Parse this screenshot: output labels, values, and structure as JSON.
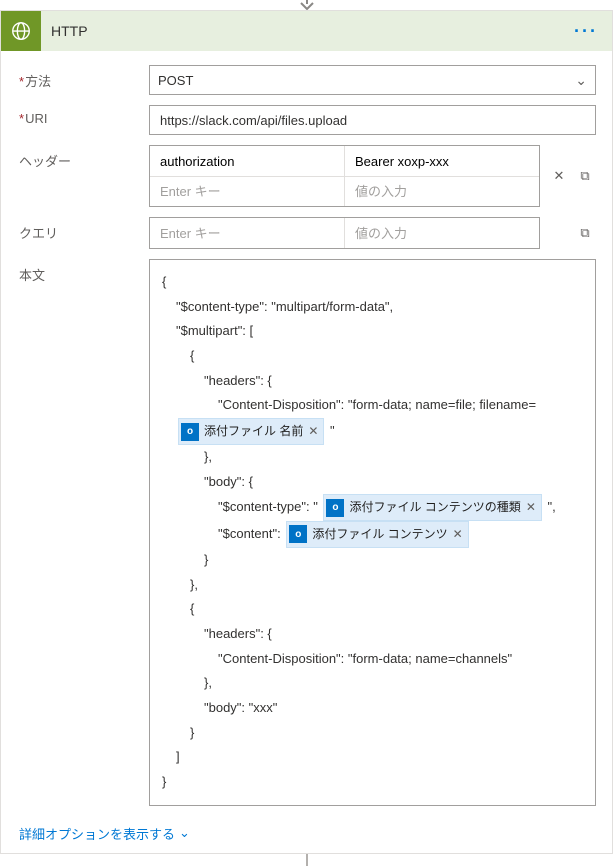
{
  "step": {
    "title": "HTTP",
    "menu_aria": "メニュー"
  },
  "labels": {
    "method": "方法",
    "uri": "URI",
    "headers": "ヘッダー",
    "queries": "クエリ",
    "body": "本文",
    "advanced": "詳細オプションを表示する"
  },
  "placeholders": {
    "enter_key": "Enter キー",
    "enter_value": "値の入力"
  },
  "fields": {
    "method": "POST",
    "uri": "https://slack.com/api/files.upload"
  },
  "headers": [
    {
      "key": "authorization",
      "value": "Bearer xoxp-xxx"
    }
  ],
  "body": {
    "l1": "{",
    "l2": "\"$content-type\": \"multipart/form-data\",",
    "l3": "\"$multipart\": [",
    "l4": "{",
    "l5": "\"headers\": {",
    "l6": "\"Content-Disposition\": \"form-data; name=file; filename=",
    "l7_after": " \"",
    "l8": "},",
    "l9": "\"body\": {",
    "l10_pre": "\"$content-type\": \"",
    "l10_post": " \",",
    "l11_pre": "\"$content\": ",
    "l12": "}",
    "l13": "},",
    "l14": "{",
    "l15": "\"headers\": {",
    "l16": "\"Content-Disposition\": \"form-data; name=channels\"",
    "l17": "},",
    "l18": "\"body\": \"xxx\"",
    "l19": "}",
    "l20": "]",
    "l21": "}"
  },
  "tokens": {
    "attachment_name": "添付ファイル 名前",
    "attachment_ctype": "添付ファイル コンテンツの種類",
    "attachment_content": "添付ファイル コンテンツ",
    "outlook_badge": "o"
  },
  "icons": {
    "close": "✕",
    "copy": "⧉",
    "chevron_down": "⌄"
  }
}
